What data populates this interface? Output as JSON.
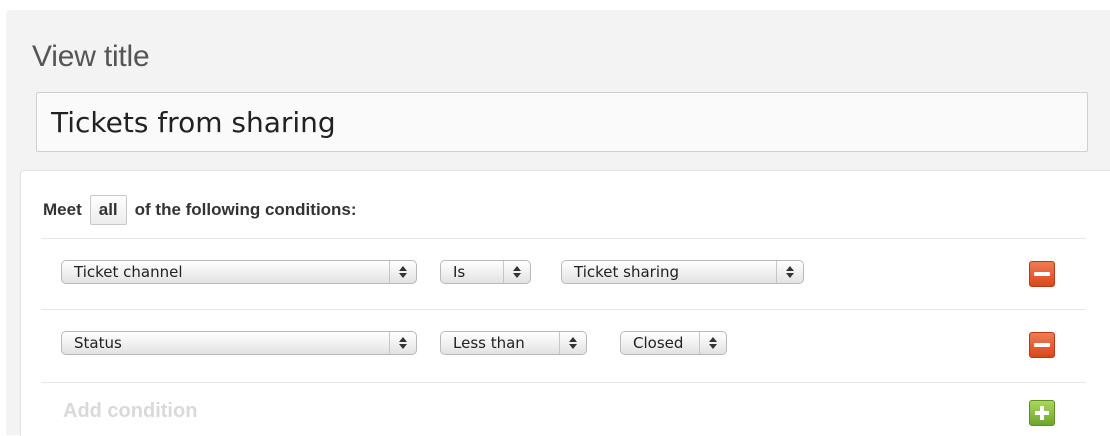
{
  "view": {
    "title_label": "View title",
    "title_value": "Tickets from sharing"
  },
  "conditions": {
    "meet_prefix": "Meet",
    "match_mode": "all",
    "meet_suffix": "of the following conditions:",
    "rows": [
      {
        "field": "Ticket channel",
        "operator": "Is",
        "value": "Ticket sharing"
      },
      {
        "field": "Status",
        "operator": "Less than",
        "value": "Closed"
      }
    ],
    "add_label": "Add condition"
  },
  "icons": {
    "remove": "minus-icon",
    "add": "plus-icon",
    "select_arrows": "select-arrows-icon"
  },
  "colors": {
    "remove_button": "#e0542a",
    "add_button": "#7fb83a",
    "panel_background": "#f3f3f3"
  }
}
